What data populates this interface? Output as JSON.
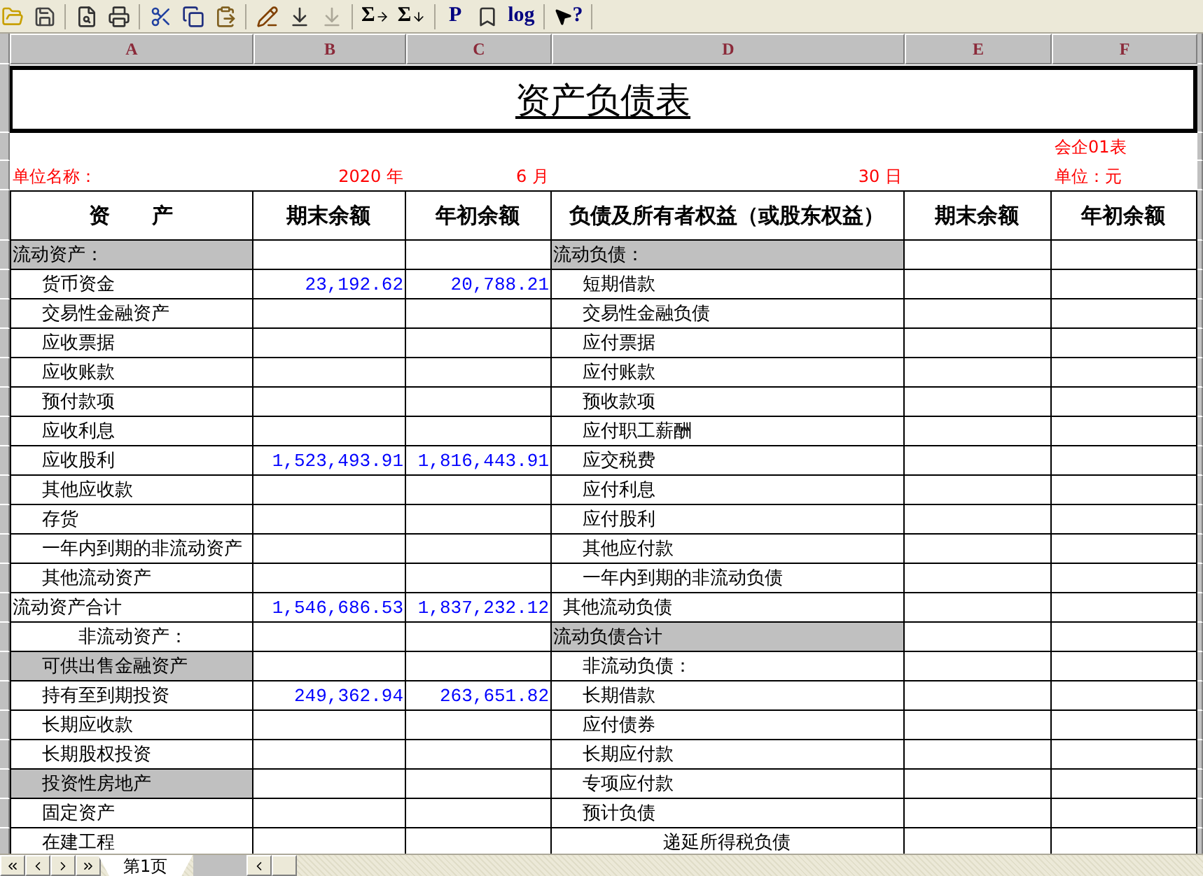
{
  "toolbar": [
    [
      {
        "kind": "open",
        "disabled": false
      },
      {
        "kind": "save",
        "disabled": false
      }
    ],
    [
      {
        "kind": "preview",
        "disabled": false
      },
      {
        "kind": "print",
        "disabled": false
      }
    ],
    [
      {
        "kind": "cut",
        "disabled": false
      },
      {
        "kind": "copy",
        "disabled": false
      },
      {
        "kind": "paste",
        "disabled": false
      }
    ],
    [
      {
        "kind": "edit",
        "disabled": false
      },
      {
        "kind": "fill",
        "disabled": false
      },
      {
        "kind": "fill",
        "disabled": true
      }
    ],
    [
      {
        "kind": "sum-right",
        "label": "Σ",
        "disabled": false
      },
      {
        "kind": "sum-down",
        "label": "Σ",
        "disabled": false
      }
    ],
    [
      {
        "kind": "text",
        "label": "P",
        "disabled": false
      },
      {
        "kind": "marker",
        "disabled": false
      },
      {
        "kind": "text",
        "label": "log",
        "disabled": false
      }
    ],
    [
      {
        "kind": "help",
        "label": "?",
        "disabled": false
      }
    ]
  ],
  "columns": [
    "A",
    "B",
    "C",
    "D",
    "E",
    "F"
  ],
  "title": "资产负债表",
  "form_code": "会企01表",
  "info": {
    "company_label": "单位名称：",
    "year": "2020 年",
    "month": "6 月",
    "day": "30 日",
    "unit": "单位：元"
  },
  "headers": [
    "资　　产",
    "期末余额",
    "年初余额",
    "负债及所有者权益（或股东权益）",
    "期末余额",
    "年初余额"
  ],
  "rows": [
    {
      "asset": {
        "label": "流动资产：",
        "shaded": true,
        "kind": "section"
      },
      "liability": {
        "label": "流动负债：",
        "shaded": true,
        "kind": "section"
      }
    },
    {
      "asset": {
        "label": "货币资金",
        "shaded": false,
        "kind": "item"
      },
      "end": "23,192.62",
      "begin": "20,788.21",
      "liability": {
        "label": "短期借款",
        "shaded": false,
        "kind": "item"
      }
    },
    {
      "asset": {
        "label": "交易性金融资产",
        "shaded": false,
        "kind": "item"
      },
      "liability": {
        "label": "交易性金融负债",
        "shaded": false,
        "kind": "item"
      }
    },
    {
      "asset": {
        "label": "应收票据",
        "shaded": false,
        "kind": "item"
      },
      "liability": {
        "label": "应付票据",
        "shaded": false,
        "kind": "item"
      }
    },
    {
      "asset": {
        "label": "应收账款",
        "shaded": false,
        "kind": "item"
      },
      "liability": {
        "label": "应付账款",
        "shaded": false,
        "kind": "item"
      }
    },
    {
      "asset": {
        "label": "预付款项",
        "shaded": false,
        "kind": "item"
      },
      "liability": {
        "label": "预收款项",
        "shaded": false,
        "kind": "item"
      }
    },
    {
      "asset": {
        "label": "应收利息",
        "shaded": false,
        "kind": "item"
      },
      "liability": {
        "label": "应付职工薪酬",
        "shaded": false,
        "kind": "item"
      }
    },
    {
      "asset": {
        "label": "应收股利",
        "shaded": false,
        "kind": "item"
      },
      "end": "1,523,493.91",
      "begin": "1,816,443.91",
      "liability": {
        "label": "应交税费",
        "shaded": false,
        "kind": "item"
      }
    },
    {
      "asset": {
        "label": "其他应收款",
        "shaded": false,
        "kind": "item"
      },
      "liability": {
        "label": "应付利息",
        "shaded": false,
        "kind": "item"
      }
    },
    {
      "asset": {
        "label": "存货",
        "shaded": false,
        "kind": "item"
      },
      "liability": {
        "label": "应付股利",
        "shaded": false,
        "kind": "item"
      }
    },
    {
      "asset": {
        "label": "一年内到期的非流动资产",
        "shaded": false,
        "kind": "item"
      },
      "liability": {
        "label": "其他应付款",
        "shaded": false,
        "kind": "item"
      }
    },
    {
      "asset": {
        "label": "其他流动资产",
        "shaded": false,
        "kind": "item"
      },
      "liability": {
        "label": "一年内到期的非流动负债",
        "shaded": false,
        "kind": "item"
      }
    },
    {
      "asset": {
        "label": "流动资产合计",
        "shaded": false,
        "kind": "total"
      },
      "end": "1,546,686.53",
      "begin": "1,837,232.12",
      "liability": {
        "label": "其他流动负债",
        "shaded": false,
        "kind": "outdented"
      }
    },
    {
      "asset": {
        "label": "非流动资产：",
        "shaded": false,
        "kind": "subsection"
      },
      "liability": {
        "label": "流动负债合计",
        "shaded": true,
        "kind": "total"
      }
    },
    {
      "asset": {
        "label": "可供出售金融资产",
        "shaded": true,
        "kind": "item"
      },
      "liability": {
        "label": "非流动负债：",
        "shaded": false,
        "kind": "item"
      }
    },
    {
      "asset": {
        "label": "持有至到期投资",
        "shaded": false,
        "kind": "item"
      },
      "end": "249,362.94",
      "begin": "263,651.82",
      "liability": {
        "label": "长期借款",
        "shaded": false,
        "kind": "item"
      }
    },
    {
      "asset": {
        "label": "长期应收款",
        "shaded": false,
        "kind": "item"
      },
      "liability": {
        "label": "应付债券",
        "shaded": false,
        "kind": "item"
      }
    },
    {
      "asset": {
        "label": "长期股权投资",
        "shaded": false,
        "kind": "item"
      },
      "liability": {
        "label": "长期应付款",
        "shaded": false,
        "kind": "item"
      }
    },
    {
      "asset": {
        "label": "投资性房地产",
        "shaded": true,
        "kind": "item"
      },
      "liability": {
        "label": "专项应付款",
        "shaded": false,
        "kind": "item"
      }
    },
    {
      "asset": {
        "label": "固定资产",
        "shaded": false,
        "kind": "item"
      },
      "liability": {
        "label": "预计负债",
        "shaded": false,
        "kind": "item"
      }
    },
    {
      "asset": {
        "label": "在建工程",
        "shaded": false,
        "kind": "item"
      },
      "liability": {
        "label": "递延所得税负债",
        "shaded": false,
        "kind": "centered"
      }
    }
  ],
  "sheet_tabs": [
    {
      "label": "第1页",
      "selected": true
    }
  ]
}
